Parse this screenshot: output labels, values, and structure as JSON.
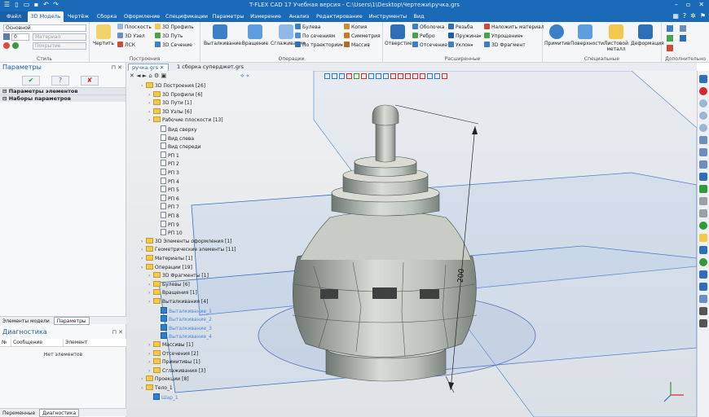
{
  "window": {
    "title": "T-FLEX CAD 17 Учебная версия - C:\\Users\\1\\Desktop\\Чертежи\\ручка.grs"
  },
  "menu": {
    "tabs": [
      "Файл",
      "3D Модель",
      "Чертёж",
      "Сборка",
      "Оформление",
      "Спецификации",
      "Параметры",
      "Измерение",
      "Анализ",
      "Редактирование",
      "Инструменты",
      "Вид"
    ],
    "active": "3D Модель"
  },
  "ribbon": {
    "style_group": {
      "label": "Стиль",
      "layer_value": "Основной",
      "level_value": "0",
      "material_placeholder": "Материал",
      "cover_placeholder": "Покрытие"
    },
    "construct_group": {
      "label": "Построения",
      "draw_label": "Чертить",
      "items": [
        "Плоскость",
        "3D Узел",
        "ЛСК",
        "3D Профиль",
        "3D Путь",
        "3D Сечение"
      ]
    },
    "operations_group": {
      "label": "Операции",
      "big": [
        "Выталкивание",
        "Вращение",
        "Сглаживание"
      ],
      "items": [
        "Булева",
        "По сечениям",
        "По траектории",
        "Копия",
        "Симметрия",
        "Массив"
      ]
    },
    "extended_group": {
      "label": "Расширенные",
      "big": [
        "Отверстие"
      ],
      "items": [
        "Оболочка",
        "Ребро",
        "Отсечение",
        "Резьба",
        "Пружина",
        "Уклон",
        "Наложить материал",
        "Упрощение",
        "3D Фрагмент"
      ]
    },
    "special_group": {
      "label": "Специальные",
      "big": [
        "Примитив",
        "Поверхности",
        "Листовой металл",
        "Деформация"
      ]
    },
    "extra_group": {
      "label": "Дополнительно"
    }
  },
  "left_panel": {
    "title": "Параметры",
    "ok": "✔",
    "apply": "?",
    "cancel": "✘",
    "section1": "Параметры элементов",
    "section2": "Наборы параметров",
    "tabs": [
      "Элементы модели",
      "Параметры"
    ],
    "diag_title": "Диагностика",
    "diag_cols": [
      "№",
      "Сообщение",
      "Элемент"
    ],
    "diag_empty": "Нет элементов",
    "bottom_tabs": [
      "Переменные",
      "Диагностика"
    ]
  },
  "doc_tabs": [
    {
      "label": "ручка.grs"
    },
    {
      "label": "1 сборка суперджет.grs"
    }
  ],
  "model_tree": [
    {
      "label": "3D Построения [26]",
      "type": "folder",
      "depth": 0
    },
    {
      "label": "3D Профили [6]",
      "type": "folder",
      "depth": 1
    },
    {
      "label": "3D Пути [1]",
      "type": "folder",
      "depth": 1
    },
    {
      "label": "3D Узлы [6]",
      "type": "folder",
      "depth": 1
    },
    {
      "label": "Рабочие плоскости [13]",
      "type": "folder",
      "depth": 1
    },
    {
      "label": "Вид сверху",
      "type": "page",
      "depth": 2
    },
    {
      "label": "Вид слева",
      "type": "page",
      "depth": 2
    },
    {
      "label": "Вид спереди",
      "type": "page",
      "depth": 2
    },
    {
      "label": "РП 1",
      "type": "page",
      "depth": 2
    },
    {
      "label": "РП 2",
      "type": "page",
      "depth": 2
    },
    {
      "label": "РП 3",
      "type": "page",
      "depth": 2
    },
    {
      "label": "РП 4",
      "type": "page",
      "depth": 2
    },
    {
      "label": "РП 5",
      "type": "page",
      "depth": 2
    },
    {
      "label": "РП 6",
      "type": "page",
      "depth": 2
    },
    {
      "label": "РП 7",
      "type": "page",
      "depth": 2
    },
    {
      "label": "РП 8",
      "type": "page",
      "depth": 2
    },
    {
      "label": "РП 9",
      "type": "page",
      "depth": 2
    },
    {
      "label": "РП 10",
      "type": "page",
      "depth": 2
    },
    {
      "label": "3D Элементы оформления [1]",
      "type": "folder",
      "depth": 0
    },
    {
      "label": "Геометрические элементы [11]",
      "type": "folder",
      "depth": 0
    },
    {
      "label": "Материалы [1]",
      "type": "folder",
      "depth": 0
    },
    {
      "label": "Операции [19]",
      "type": "folder",
      "depth": 0
    },
    {
      "label": "3D Фрагменты [1]",
      "type": "folder",
      "depth": 1
    },
    {
      "label": "Булевы [6]",
      "type": "folder",
      "depth": 1
    },
    {
      "label": "Вращения [1]",
      "type": "folder",
      "depth": 1
    },
    {
      "label": "Выталкивания [4]",
      "type": "folder",
      "depth": 1
    },
    {
      "label": "Выталкивание_1",
      "type": "check",
      "depth": 2
    },
    {
      "label": "Выталкивание_2",
      "type": "check",
      "depth": 2
    },
    {
      "label": "Выталкивание_3",
      "type": "check",
      "depth": 2
    },
    {
      "label": "Выталкивание_4",
      "type": "check",
      "depth": 2
    },
    {
      "label": "Массивы [1]",
      "type": "folder",
      "depth": 1
    },
    {
      "label": "Отсечения [2]",
      "type": "folder",
      "depth": 1
    },
    {
      "label": "Примитивы [1]",
      "type": "folder",
      "depth": 1
    },
    {
      "label": "Сглаживания [3]",
      "type": "folder",
      "depth": 1
    },
    {
      "label": "Проекции [8]",
      "type": "folder",
      "depth": 0
    },
    {
      "label": "Тело_1",
      "type": "folder",
      "depth": 0
    },
    {
      "label": "Шар_1",
      "type": "check",
      "depth": 1
    }
  ],
  "viewport": {
    "dimension": "200"
  }
}
